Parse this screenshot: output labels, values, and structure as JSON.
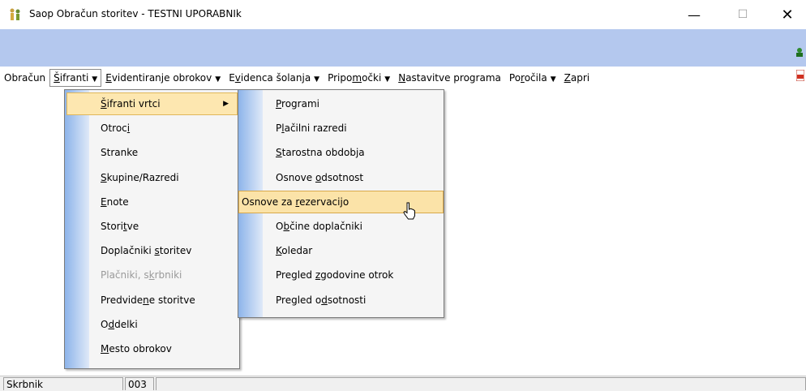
{
  "window": {
    "title": "Saop Obračun storitev - TESTNI UPORABNIk",
    "controls": {
      "minimize": "—",
      "maximize": "☐",
      "close": "✕"
    }
  },
  "menubar": [
    {
      "id": "obracun",
      "pre": "Obračun",
      "u": "",
      "post": "",
      "arrow": ""
    },
    {
      "id": "sifranti",
      "pre": "",
      "u": "Š",
      "post": "ifranti",
      "arrow": "▼"
    },
    {
      "id": "evidentiranje",
      "pre": "",
      "u": "E",
      "post": "videntiranje obrokov",
      "arrow": "▼"
    },
    {
      "id": "evidenca",
      "pre": "E",
      "u": "v",
      "post": "idenca šolanja",
      "arrow": "▼"
    },
    {
      "id": "pripomocki",
      "pre": "Pripo",
      "u": "m",
      "post": "očki",
      "arrow": "▼"
    },
    {
      "id": "nastavitve",
      "pre": "",
      "u": "N",
      "post": "astavitve programa",
      "arrow": ""
    },
    {
      "id": "porocila",
      "pre": "Po",
      "u": "r",
      "post": "očila",
      "arrow": "▼"
    },
    {
      "id": "zapri",
      "pre": "",
      "u": "Z",
      "post": "apri",
      "arrow": ""
    }
  ],
  "menu1": [
    {
      "pre": "",
      "u": "Š",
      "post": "ifranti vrtci",
      "arrow": "▶",
      "state": "highlighted"
    },
    {
      "pre": "Otroc",
      "u": "i",
      "post": "",
      "state": "normal"
    },
    {
      "pre": "Stranke",
      "u": "",
      "post": "",
      "state": "normal"
    },
    {
      "pre": "",
      "u": "S",
      "post": "kupine/Razredi",
      "state": "normal"
    },
    {
      "pre": "",
      "u": "E",
      "post": "note",
      "state": "normal"
    },
    {
      "pre": "Stori",
      "u": "t",
      "post": "ve",
      "state": "normal"
    },
    {
      "pre": "Doplačniki ",
      "u": "s",
      "post": "toritev",
      "state": "normal"
    },
    {
      "pre": "Plačniki, s",
      "u": "k",
      "post": "rbniki",
      "state": "disabled"
    },
    {
      "pre": "Predvide",
      "u": "n",
      "post": "e storitve",
      "state": "normal"
    },
    {
      "pre": "O",
      "u": "d",
      "post": "delki",
      "state": "normal"
    },
    {
      "pre": "",
      "u": "M",
      "post": "esto obrokov",
      "state": "normal"
    }
  ],
  "menu2": [
    {
      "pre": "",
      "u": "P",
      "post": "rogrami",
      "state": "normal"
    },
    {
      "pre": "P",
      "u": "l",
      "post": "ačilni razredi",
      "state": "normal"
    },
    {
      "pre": "",
      "u": "S",
      "post": "tarostna obdobja",
      "state": "normal"
    },
    {
      "pre": "Osnove ",
      "u": "o",
      "post": "dsotnost",
      "state": "normal"
    },
    {
      "pre": "Osnove za ",
      "u": "r",
      "post": "ezervacijo",
      "state": "highlighted"
    },
    {
      "pre": "O",
      "u": "b",
      "post": "čine doplačniki",
      "state": "normal"
    },
    {
      "pre": "",
      "u": "K",
      "post": "oledar",
      "state": "normal"
    },
    {
      "pre": "Pregled ",
      "u": "z",
      "post": "godovine otrok",
      "state": "normal"
    },
    {
      "pre": "Pregled o",
      "u": "d",
      "post": "sotnosti",
      "state": "normal"
    }
  ],
  "statusbar": {
    "cell1": "Skrbnik",
    "cell2": "003",
    "cell3": ""
  },
  "colors": {
    "band": "#b4c8ee",
    "highlight": "#fde7b0",
    "gutter": "#8db4ea"
  }
}
